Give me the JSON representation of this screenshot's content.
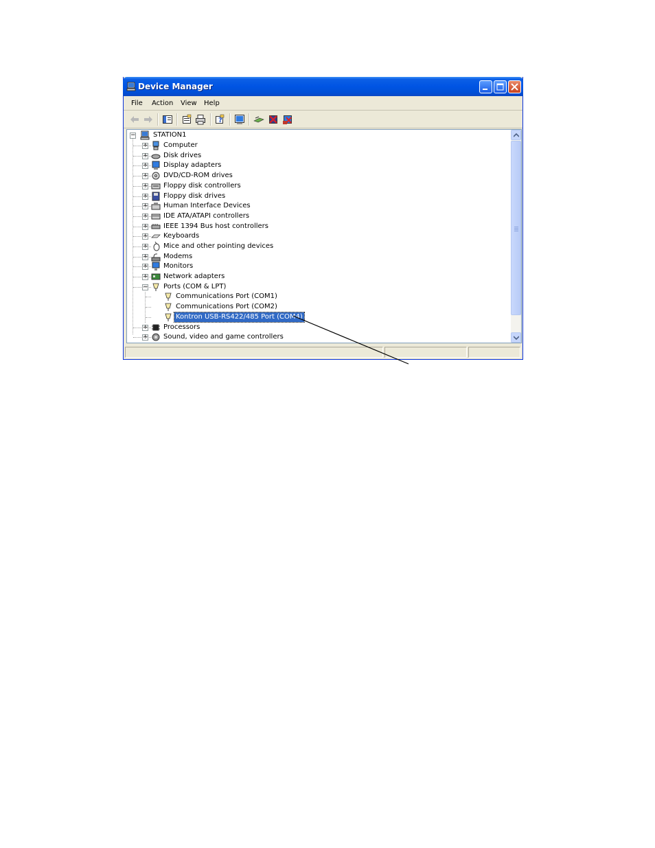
{
  "window": {
    "title": "Device Manager"
  },
  "menu": [
    "File",
    "Action",
    "View",
    "Help"
  ],
  "toolbar": {
    "buttons": [
      "back-icon",
      "forward-icon",
      "console-tree-icon",
      "properties-icon",
      "print-icon",
      "help-icon",
      "update-driver-icon",
      "scan-hardware-icon",
      "disable-device-icon",
      "uninstall-device-icon"
    ]
  },
  "tree": {
    "root": "STATION1",
    "categories": [
      {
        "label": "Computer",
        "icon": "computer-icon"
      },
      {
        "label": "Disk drives",
        "icon": "disk-drive-icon"
      },
      {
        "label": "Display adapters",
        "icon": "display-adapter-icon"
      },
      {
        "label": "DVD/CD-ROM drives",
        "icon": "cdrom-icon"
      },
      {
        "label": "Floppy disk controllers",
        "icon": "floppy-controller-icon"
      },
      {
        "label": "Floppy disk drives",
        "icon": "floppy-drive-icon"
      },
      {
        "label": "Human Interface Devices",
        "icon": "hid-icon"
      },
      {
        "label": "IDE ATA/ATAPI controllers",
        "icon": "ide-controller-icon"
      },
      {
        "label": "IEEE 1394 Bus host controllers",
        "icon": "ieee1394-icon"
      },
      {
        "label": "Keyboards",
        "icon": "keyboard-icon"
      },
      {
        "label": "Mice and other pointing devices",
        "icon": "mouse-icon"
      },
      {
        "label": "Modems",
        "icon": "modem-icon"
      },
      {
        "label": "Monitors",
        "icon": "monitor-icon"
      },
      {
        "label": "Network adapters",
        "icon": "network-adapter-icon"
      },
      {
        "label": "Ports (COM & LPT)",
        "icon": "port-icon"
      }
    ],
    "ports": [
      {
        "label": "Communications Port (COM1)",
        "icon": "port-icon"
      },
      {
        "label": "Communications Port (COM2)",
        "icon": "port-icon"
      },
      {
        "label": "Kontron USB-RS422/485 Port (COM4)",
        "icon": "port-icon"
      }
    ],
    "after": [
      {
        "label": "Processors",
        "icon": "processor-icon"
      },
      {
        "label": "Sound, video and game controllers",
        "icon": "sound-icon"
      }
    ]
  },
  "colors": {
    "titlebar": "#0054e3",
    "selection": "#316ac5",
    "chrome": "#ece9d8"
  }
}
